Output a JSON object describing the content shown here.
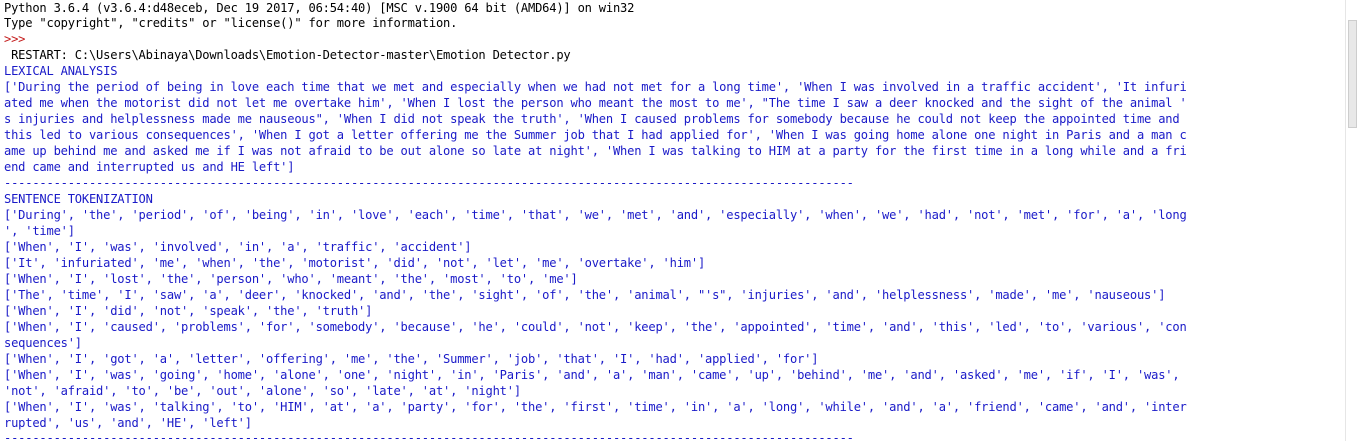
{
  "shell": {
    "banner_line1": "Python 3.6.4 (v3.6.4:d48eceb, Dec 19 2017, 06:54:40) [MSC v.1900 64 bit (AMD64)] on win32",
    "banner_line2": "Type \"copyright\", \"credits\" or \"license()\" for more information.",
    "prompt": ">>> ",
    "restart": " RESTART: C:\\Users\\Abinaya\\Downloads\\Emotion-Detector-master\\Emotion Detector.py"
  },
  "lexical": {
    "heading": "LEXICAL ANALYSIS",
    "lines": [
      "['During the period of being in love each time that we met and especially when we had not met for a long time', 'When I was involved in a traffic accident', 'It infuri",
      "ated me when the motorist did not let me overtake him', 'When I lost the person who meant the most to me', \"The time I saw a deer knocked and the sight of the animal '",
      "s injuries and helplessness made me nauseous\", 'When I did not speak the truth', 'When I caused problems for somebody because he could not keep the appointed time and",
      "this led to various consequences', 'When I got a letter offering me the Summer job that I had applied for', 'When I was going home alone one night in Paris and a man c",
      "ame up behind me and asked me if I was not afraid to be out alone so late at night', 'When I was talking to HIM at a party for the first time in a long while and a fri",
      "end came and interrupted us and HE left']"
    ]
  },
  "separator": "------------------------------------------------------------------------------------------------------------------------",
  "tokenization": {
    "heading": "SENTENCE TOKENIZATION",
    "lines": [
      "['During', 'the', 'period', 'of', 'being', 'in', 'love', 'each', 'time', 'that', 'we', 'met', 'and', 'especially', 'when', 'we', 'had', 'not', 'met', 'for', 'a', 'long",
      "', 'time']",
      "['When', 'I', 'was', 'involved', 'in', 'a', 'traffic', 'accident']",
      "['It', 'infuriated', 'me', 'when', 'the', 'motorist', 'did', 'not', 'let', 'me', 'overtake', 'him']",
      "['When', 'I', 'lost', 'the', 'person', 'who', 'meant', 'the', 'most', 'to', 'me']",
      "['The', 'time', 'I', 'saw', 'a', 'deer', 'knocked', 'and', 'the', 'sight', 'of', 'the', 'animal', \"'s\", 'injuries', 'and', 'helplessness', 'made', 'me', 'nauseous']",
      "['When', 'I', 'did', 'not', 'speak', 'the', 'truth']",
      "['When', 'I', 'caused', 'problems', 'for', 'somebody', 'because', 'he', 'could', 'not', 'keep', 'the', 'appointed', 'time', 'and', 'this', 'led', 'to', 'various', 'con",
      "sequences']",
      "['When', 'I', 'got', 'a', 'letter', 'offering', 'me', 'the', 'Summer', 'job', 'that', 'I', 'had', 'applied', 'for']",
      "['When', 'I', 'was', 'going', 'home', 'alone', 'one', 'night', 'in', 'Paris', 'and', 'a', 'man', 'came', 'up', 'behind', 'me', 'and', 'asked', 'me', 'if', 'I', 'was',",
      "'not', 'afraid', 'to', 'be', 'out', 'alone', 'so', 'late', 'at', 'night']",
      "['When', 'I', 'was', 'talking', 'to', 'HIM', 'at', 'a', 'party', 'for', 'the', 'first', 'time', 'in', 'a', 'long', 'while', 'and', 'a', 'friend', 'came', 'and', 'inter",
      "rupted', 'us', 'and', 'HE', 'left']"
    ]
  },
  "colors": {
    "output_text": "#1a1ac8",
    "banner_text": "#000000",
    "prompt": "#c41c1c",
    "background": "#ffffff"
  }
}
